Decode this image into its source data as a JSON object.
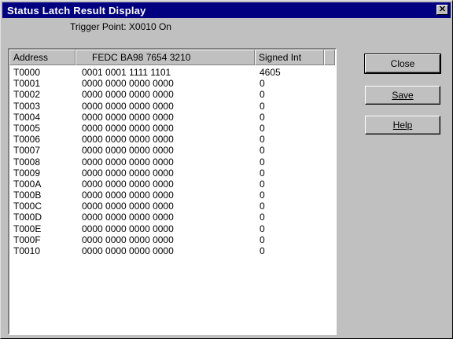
{
  "window": {
    "title": "Status Latch Result Display",
    "close_glyph": "✕"
  },
  "trigger_point": "Trigger Point: X0010 On",
  "table": {
    "headers": [
      "Address",
      "FEDC BA98 7654 3210",
      "Signed Int"
    ],
    "rows": [
      [
        "T0000",
        "0001 0001 1111 1101",
        "4605"
      ],
      [
        "T0001",
        "0000 0000 0000 0000",
        "0"
      ],
      [
        "T0002",
        "0000 0000 0000 0000",
        "0"
      ],
      [
        "T0003",
        "0000 0000 0000 0000",
        "0"
      ],
      [
        "T0004",
        "0000 0000 0000 0000",
        "0"
      ],
      [
        "T0005",
        "0000 0000 0000 0000",
        "0"
      ],
      [
        "T0006",
        "0000 0000 0000 0000",
        "0"
      ],
      [
        "T0007",
        "0000 0000 0000 0000",
        "0"
      ],
      [
        "T0008",
        "0000 0000 0000 0000",
        "0"
      ],
      [
        "T0009",
        "0000 0000 0000 0000",
        "0"
      ],
      [
        "T000A",
        "0000 0000 0000 0000",
        "0"
      ],
      [
        "T000B",
        "0000 0000 0000 0000",
        "0"
      ],
      [
        "T000C",
        "0000 0000 0000 0000",
        "0"
      ],
      [
        "T000D",
        "0000 0000 0000 0000",
        "0"
      ],
      [
        "T000E",
        "0000 0000 0000 0000",
        "0"
      ],
      [
        "T000F",
        "0000 0000 0000 0000",
        "0"
      ],
      [
        "T0010",
        "0000 0000 0000 0000",
        "0"
      ]
    ]
  },
  "buttons": {
    "close": "Close",
    "save": "Save",
    "help": "Help"
  },
  "colors": {
    "titlebar": "#000080",
    "face": "#c0c0c0"
  }
}
